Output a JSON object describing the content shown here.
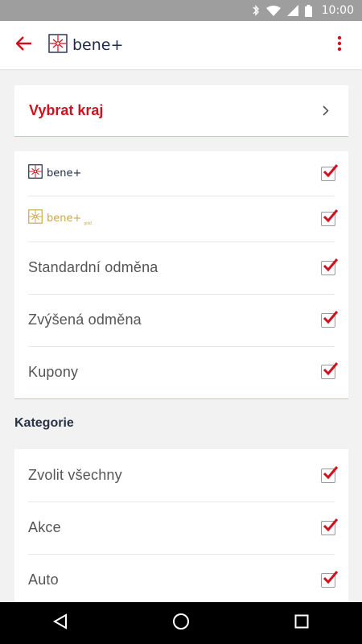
{
  "status_bar": {
    "time": "10:00",
    "icons": [
      "bluetooth-icon",
      "wifi-icon",
      "signal-icon",
      "battery-icon"
    ],
    "background": "#9e9e9e"
  },
  "app_bar": {
    "title": "bene+",
    "back_icon": "arrow-left-icon",
    "menu_icon": "more-vert-icon",
    "accent": "#d3101d"
  },
  "region": {
    "label": "Vybrat kraj",
    "chevron_icon": "chevron-right-icon"
  },
  "filters": [
    {
      "kind": "logo",
      "label": "bene+",
      "checked": true
    },
    {
      "kind": "logo-gold",
      "label": "bene+",
      "sublabel": "gold",
      "checked": true
    },
    {
      "kind": "text",
      "label": "Standardní odměna",
      "checked": true
    },
    {
      "kind": "text",
      "label": "Zvýšená odměna",
      "checked": true
    },
    {
      "kind": "text",
      "label": "Kupony",
      "checked": true
    }
  ],
  "categories": {
    "title": "Kategorie",
    "items": [
      {
        "label": "Zvolit všechny",
        "checked": true
      },
      {
        "label": "Akce",
        "checked": true
      },
      {
        "label": "Auto",
        "checked": true
      }
    ]
  },
  "nav_bar": {
    "buttons": [
      "back-triangle-icon",
      "home-circle-icon",
      "recents-square-icon"
    ]
  },
  "colors": {
    "accent_red": "#d3101d",
    "divider_pink": "#f3b3b8",
    "gold": "#c9a94a",
    "navy": "#1f2a44"
  }
}
